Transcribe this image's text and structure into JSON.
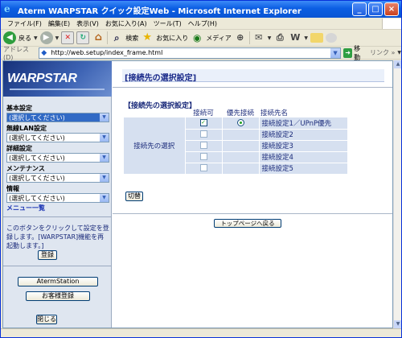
{
  "window": {
    "title": "Aterm WARPSTAR クイック設定Web - Microsoft Internet Explorer",
    "buttons": {
      "minimize": "_",
      "maximize": "□",
      "close": "×"
    }
  },
  "menubar": [
    "ファイル(F)",
    "編集(E)",
    "表示(V)",
    "お気に入り(A)",
    "ツール(T)",
    "ヘルプ(H)"
  ],
  "toolbar": {
    "back": "戻る",
    "search": "検索",
    "favorites": "お気に入り",
    "media": "メディア"
  },
  "addressbar": {
    "label": "アドレス(D)",
    "url": "http://web.setup/index_frame.html",
    "go": "移動",
    "links": "リンク »"
  },
  "sidebar": {
    "logo": "WARPSTAR",
    "groups": [
      {
        "label": "基本設定",
        "value": "(選択してください)",
        "active": true
      },
      {
        "label": "無線LAN設定",
        "value": "(選択してください)",
        "active": false
      },
      {
        "label": "詳細設定",
        "value": "(選択してください)",
        "active": false
      },
      {
        "label": "メンテナンス",
        "value": "(選択してください)",
        "active": false
      },
      {
        "label": "情報",
        "value": "(選択してください)",
        "active": false
      }
    ],
    "menu_list": "メニュー一覧",
    "restart_note": "このボタンをクリックして設定を登録します。[WARPSTAR]機能を再起動します。]",
    "register": "登録",
    "atermstation": "AtermStation",
    "customer_register": "お客様登録",
    "close": "閉じる"
  },
  "main": {
    "page_title": "[接続先の選択設定]",
    "section_title": "【接続先の選択設定】",
    "columns": {
      "enable": "接続可",
      "priority": "優先接続",
      "name": "接続先名"
    },
    "row_header": "接続先の選択",
    "rows": [
      {
        "name": "接続設定1／UPnP優先",
        "enabled": true,
        "priority": true
      },
      {
        "name": "接続設定2",
        "enabled": false,
        "priority": false
      },
      {
        "name": "接続設定3",
        "enabled": false,
        "priority": false
      },
      {
        "name": "接続設定4",
        "enabled": false,
        "priority": false
      },
      {
        "name": "接続設定5",
        "enabled": false,
        "priority": false
      }
    ],
    "switch_button": "切替",
    "top_button": "トップページへ戻る"
  },
  "colors": {
    "titlebar": "#0a55d3",
    "table_bg": "#d6e0f0",
    "heading": "#1a2a7a",
    "select_highlight": "#316ac5"
  }
}
